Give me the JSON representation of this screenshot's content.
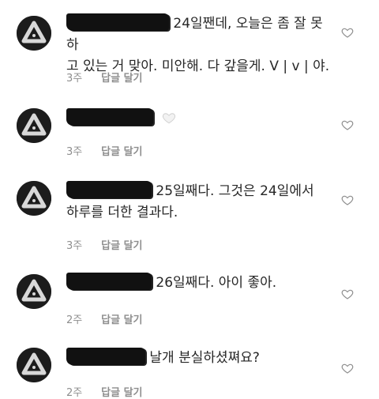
{
  "comments": [
    {
      "text_line1": "24일짼데, 오늘은 좀 잘 못 하",
      "text_line2": "고 있는 거 맞아. 미안해. 다 갚을게. V | v | 야.",
      "time": "3주",
      "reply": "답글 달기"
    },
    {
      "text_line1": "",
      "text_line2": "",
      "emoji": "🤍",
      "time": "3주",
      "reply": "답글 달기"
    },
    {
      "text_line1": "25일째다. 그것은 24일에서",
      "text_line2": "하루를 더한 결과다.",
      "time": "3주",
      "reply": "답글 달기"
    },
    {
      "text_line1": "26일째다. 아이 좋아.",
      "text_line2": "",
      "time": "2주",
      "reply": "답글 달기"
    },
    {
      "text_line1": "날개 분실하셨쪄요?",
      "text_line2": "",
      "time": "2주",
      "reply": "답글 달기"
    }
  ],
  "icons": {
    "like": "heart-outline-icon",
    "avatar": "triangle-logo-avatar"
  },
  "colors": {
    "meta": "#8e8e8e",
    "text": "#262626",
    "redaction": "#111111"
  }
}
